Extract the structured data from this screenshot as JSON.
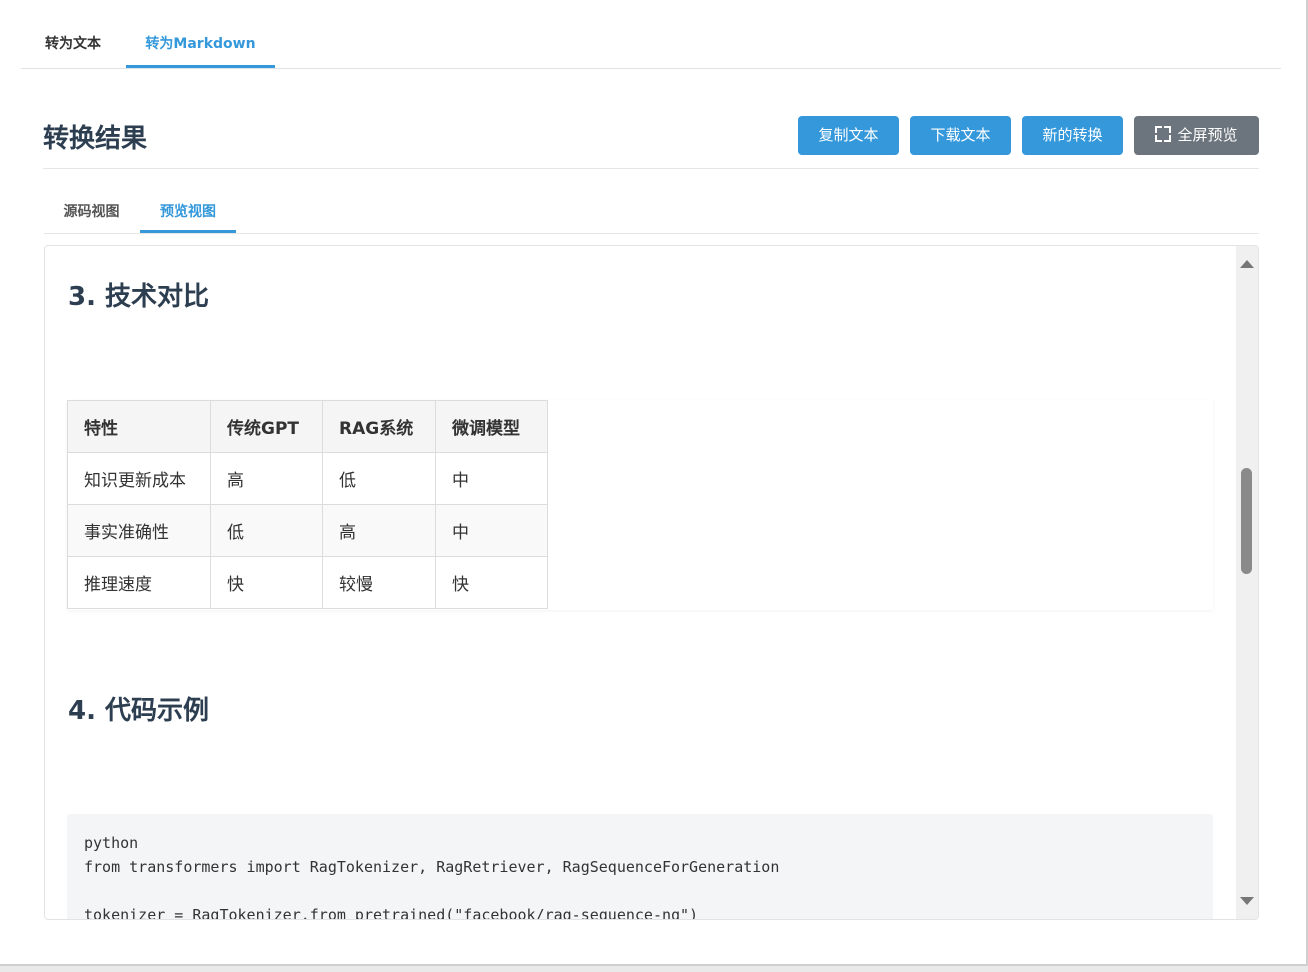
{
  "top_tabs": [
    {
      "label": "转为文本"
    },
    {
      "label": "转为Markdown"
    }
  ],
  "result": {
    "title": "转换结果",
    "buttons": {
      "copy": "复制文本",
      "download": "下载文本",
      "new": "新的转换",
      "fullscreen": "全屏预览"
    }
  },
  "view_tabs": [
    {
      "label": "源码视图"
    },
    {
      "label": "预览视图"
    }
  ],
  "preview": {
    "section3_title": "3. 技术对比",
    "table": {
      "headers": [
        "特性",
        "传统GPT",
        "RAG系统",
        "微调模型"
      ],
      "rows": [
        [
          "知识更新成本",
          "高",
          "低",
          "中"
        ],
        [
          "事实准确性",
          "低",
          "高",
          "中"
        ],
        [
          "推理速度",
          "快",
          "较慢",
          "快"
        ]
      ]
    },
    "section4_title": "4. 代码示例",
    "code_lines": [
      "python",
      "from transformers import RagTokenizer, RagRetriever, RagSequenceForGeneration",
      "tokenizer = RagTokenizer.from_pretrained(\"facebook/rag-sequence-nq\")"
    ]
  },
  "icons": {
    "fullscreen": "fullscreen-icon",
    "scroll_up": "scroll-up-arrow",
    "scroll_down": "scroll-down-arrow"
  },
  "colors": {
    "accent": "#3498db",
    "secondary_button": "#6c757d",
    "heading": "#2c3e50"
  }
}
